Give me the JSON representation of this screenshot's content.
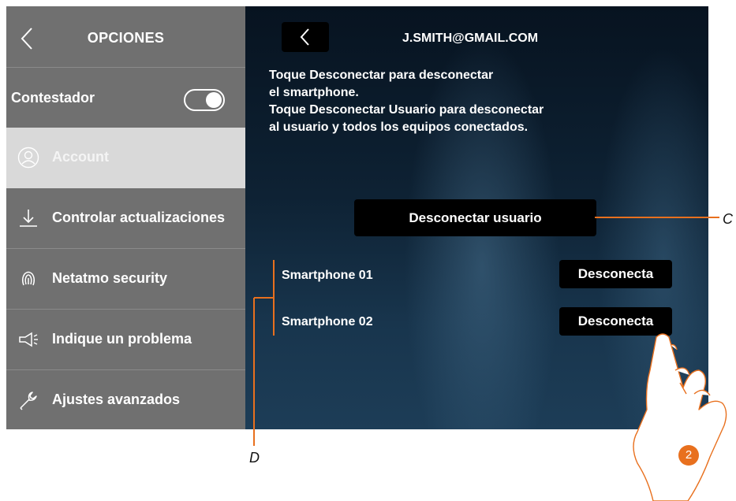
{
  "sidebar": {
    "title": "OPCIONES",
    "contestador": {
      "label": "Contestador",
      "toggle_on": true
    },
    "items": [
      {
        "label": "Account",
        "icon": "user-circle-icon",
        "selected": true
      },
      {
        "label": "Controlar actualizaciones",
        "icon": "download-arrow-icon",
        "selected": false
      },
      {
        "label": "Netatmo security",
        "icon": "fingerprint-icon",
        "selected": false
      },
      {
        "label": "Indique un problema",
        "icon": "megaphone-icon",
        "selected": false
      },
      {
        "label": "Ajustes avanzados",
        "icon": "wrench-icon",
        "selected": false
      }
    ]
  },
  "main": {
    "title": "J.SMITH@GMAIL.COM",
    "instructions": [
      "Toque Desconectar para desconectar",
      "el smartphone.",
      "Toque Desconectar Usuario para desconectar",
      "al usuario y todos los equipos conectados."
    ],
    "disconnect_user_label": "Desconectar usuario",
    "devices": [
      {
        "name": "Smartphone 01",
        "button_label": "Desconecta"
      },
      {
        "name": "Smartphone 02",
        "button_label": "Desconecta"
      }
    ]
  },
  "annotations": {
    "callout_c": "C",
    "callout_d": "D",
    "step": "2",
    "accent_color": "#e8701e"
  }
}
